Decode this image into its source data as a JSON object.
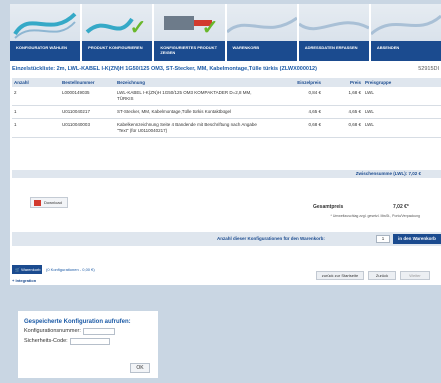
{
  "steps": [
    {
      "label": "KONFIGURATOR WÄHLEN",
      "done": false
    },
    {
      "label": "PRODUKT KONFIGURIEREN",
      "done": true
    },
    {
      "label": "KONFIGURIERTES PRODUKT ZEIGEN",
      "done": true
    },
    {
      "label": "WARENKORB",
      "done": false
    },
    {
      "label": "ADRESSDATEN ERFASSEN",
      "done": false
    },
    {
      "label": "ABSENDEN",
      "done": false
    }
  ],
  "item_heading": "Einzelstückliste: 2m, LWL-KABEL I-K(ZN)H 1G50/125 OM3, ST-Stecker, MM, Kabelmontage,Tülle türkis (ZLWX000012)",
  "item_extra": "52915DI",
  "table": {
    "headers": [
      "Anzahl",
      "Bestellnummer",
      "Bezeichnung",
      "Einzelpreis",
      "Preis",
      "Preisgruppe"
    ],
    "rows": [
      {
        "qty": "2",
        "order_no": "L0000149035",
        "desc": "LWL-KABEL I-K(ZN)H 1G50/125 OM3 KOMPAKTADER D=2,8 MM, TÜRKIS",
        "unit": "0,84 €",
        "price": "1,68 €",
        "group": "LWL"
      },
      {
        "qty": "1",
        "order_no": "U0110040217",
        "desc": "ST-Stecker, MM, Kabelmontage,Tülle türkis Kontaktbügel",
        "unit": "4,65 €",
        "price": "4,65 €",
        "group": "LWL"
      },
      {
        "qty": "1",
        "order_no": "U0110040003",
        "desc": "Kabelkennzeichnung Seite 4 Bandende mit Beschriftung nach Angabe \"Text\" (für U0110040217)",
        "unit": "0,68 €",
        "price": "0,68 €",
        "group": "LWL"
      }
    ]
  },
  "subtotal": "Zwischensumme (LWL): 7,02 €",
  "download": "Download",
  "total_label": "Gesamtpreis",
  "total_value": "7,02 €*",
  "vat_note": "* Umweltzuschlag zzgl. gesetzl. MwSt., Porto/Verpackung",
  "cart_bar": {
    "label": "Anzahl dieser Konfigurationen für den Warenkorb:",
    "qty": "1",
    "button": "in den Warenkorb"
  },
  "cart_tab": "Warenkorb",
  "cart_summary": "(0 Konfigurationen - 0,00 €)",
  "brand": "Integration",
  "nav": {
    "back_start": "zurück zur Startseite",
    "back": "Zurück",
    "next": "Weiter"
  },
  "saved": {
    "title": "Gespeicherte Konfiguration aufrufen:",
    "config_label": "Konfigurationsnummer:",
    "code_label": "Sicherheits-Code:",
    "ok": "OK"
  },
  "colors": {
    "brand_blue": "#1b4b8f",
    "link_blue": "#1b5aa6",
    "check_green": "#6ab72c",
    "page_bg": "#c9d6e3"
  }
}
